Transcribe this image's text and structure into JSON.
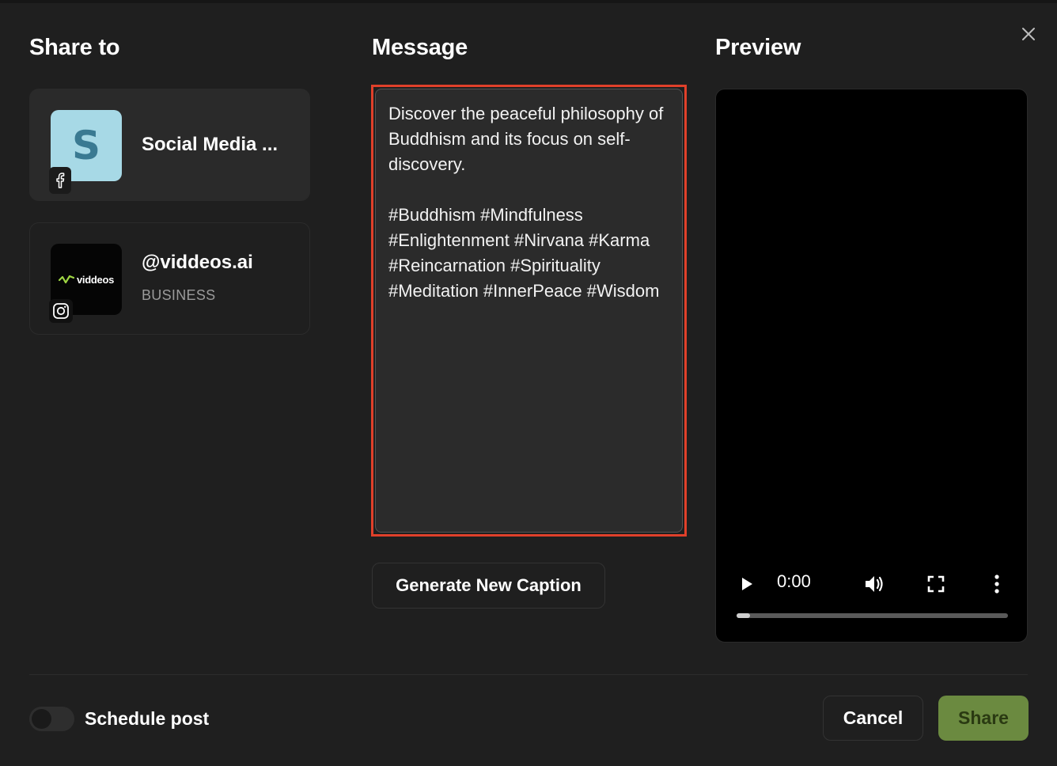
{
  "columns": {
    "share_to": "Share to",
    "message": "Message",
    "preview": "Preview"
  },
  "accounts": [
    {
      "avatar_letter": "S",
      "name": "Social Media ...",
      "subtitle": "",
      "platform": "facebook-icon"
    },
    {
      "avatar_logo": "viddeos",
      "name": "@viddeos.ai",
      "subtitle": "BUSINESS",
      "platform": "instagram-icon"
    }
  ],
  "message": {
    "text": "Discover the peaceful philosophy of Buddhism and its focus on self-discovery.\n\n#Buddhism #Mindfulness #Enlightenment #Nirvana #Karma #Reincarnation #Spirituality #Meditation #InnerPeace #Wisdom"
  },
  "generate_button": "Generate New Caption",
  "video": {
    "time": "0:00",
    "progress": 0.05
  },
  "footer": {
    "schedule_label": "Schedule post",
    "schedule_enabled": false,
    "cancel_label": "Cancel",
    "share_label": "Share"
  },
  "colors": {
    "highlight": "#e0402a",
    "share_button": "#6b8a40",
    "avatar_s": "#a7d9e6"
  }
}
